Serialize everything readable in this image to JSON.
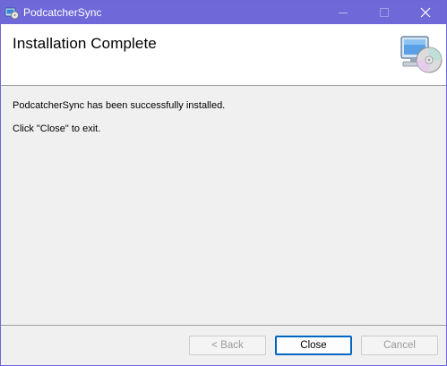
{
  "window": {
    "title": "PodcatcherSync",
    "app_icon": "installer-app-icon",
    "controls": [
      "minimize-icon",
      "maximize-icon",
      "close-icon"
    ],
    "titlebar_color": "#6f68d8"
  },
  "header": {
    "title": "Installation Complete",
    "icon": "computer-cd-icon"
  },
  "content": {
    "message": "PodcatcherSync has been successfully installed.",
    "instruction": "Click \"Close\" to exit."
  },
  "buttons": {
    "back": "< Back",
    "close": "Close",
    "cancel": "Cancel"
  }
}
